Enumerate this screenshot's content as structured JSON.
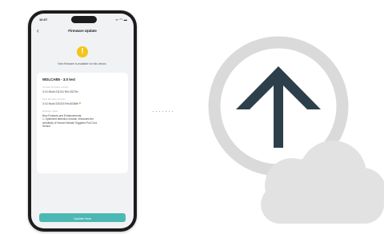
{
  "status_bar": {
    "time": "10:07",
    "icons": "▪▪ ◠ ▬"
  },
  "nav": {
    "title": "Firmware Update"
  },
  "notice": "New firmware is available for this device.",
  "card": {
    "device_name": "WDLCAB5 - 3.0 test",
    "current_version_label": "Current firmware version",
    "current_version": "3.0.0 Build 211011 Rel.43276n",
    "latest_version_label": "New firmware version",
    "latest_version": "3.0.0 Build 220215 Rel.60369n",
    "release_notes_label": "Release notes",
    "release_notes": [
      "New Features and Enhancements:",
      "1. Optimized detection module, enhances the",
      "sensitivity of Human Sedate-Triggered Pull Cord",
      "Sensor."
    ]
  },
  "update_button_label": "Update Now",
  "colors": {
    "accent": "#4cb8b3",
    "info": "#f3c51a",
    "arrow": "#2d3f4a",
    "ring": "#dadada",
    "cloud": "#e2e2e2"
  },
  "icons": {
    "back": "chevron-left-icon",
    "info": "info-icon",
    "upload": "upload-arrow-icon",
    "cloud": "cloud-icon"
  }
}
